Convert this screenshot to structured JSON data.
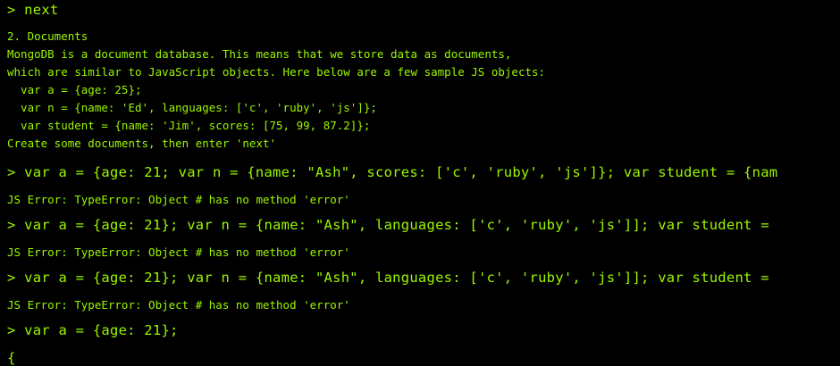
{
  "terminal": {
    "text_color": "#9bf700",
    "background": "#000000",
    "lines": [
      "> next",
      "2. Documents",
      "MongoDB is a document database. This means that we store data as documents,",
      "which are similar to JavaScript objects. Here below are a few sample JS objects:",
      "  var a = {age: 25};",
      "  var n = {name: 'Ed', languages: ['c', 'ruby', 'js']};",
      "  var student = {name: 'Jim', scores: [75, 99, 87.2]};",
      "Create some documents, then enter 'next'",
      "> var a = {age: 21; var n = {name: \"Ash\", scores: ['c', 'ruby', 'js']}; var student = {nam",
      "JS Error: TypeError: Object # has no method 'error'",
      "> var a = {age: 21}; var n = {name: \"Ash\", languages: ['c', 'ruby', 'js']]; var student =",
      "JS Error: TypeError: Object # has no method 'error'",
      "> var a = {age: 21}; var n = {name: \"Ash\", languages: ['c', 'ruby', 'js']]; var student =",
      "JS Error: TypeError: Object # has no method 'error'",
      "> var a = {age: 21};",
      "{"
    ]
  }
}
